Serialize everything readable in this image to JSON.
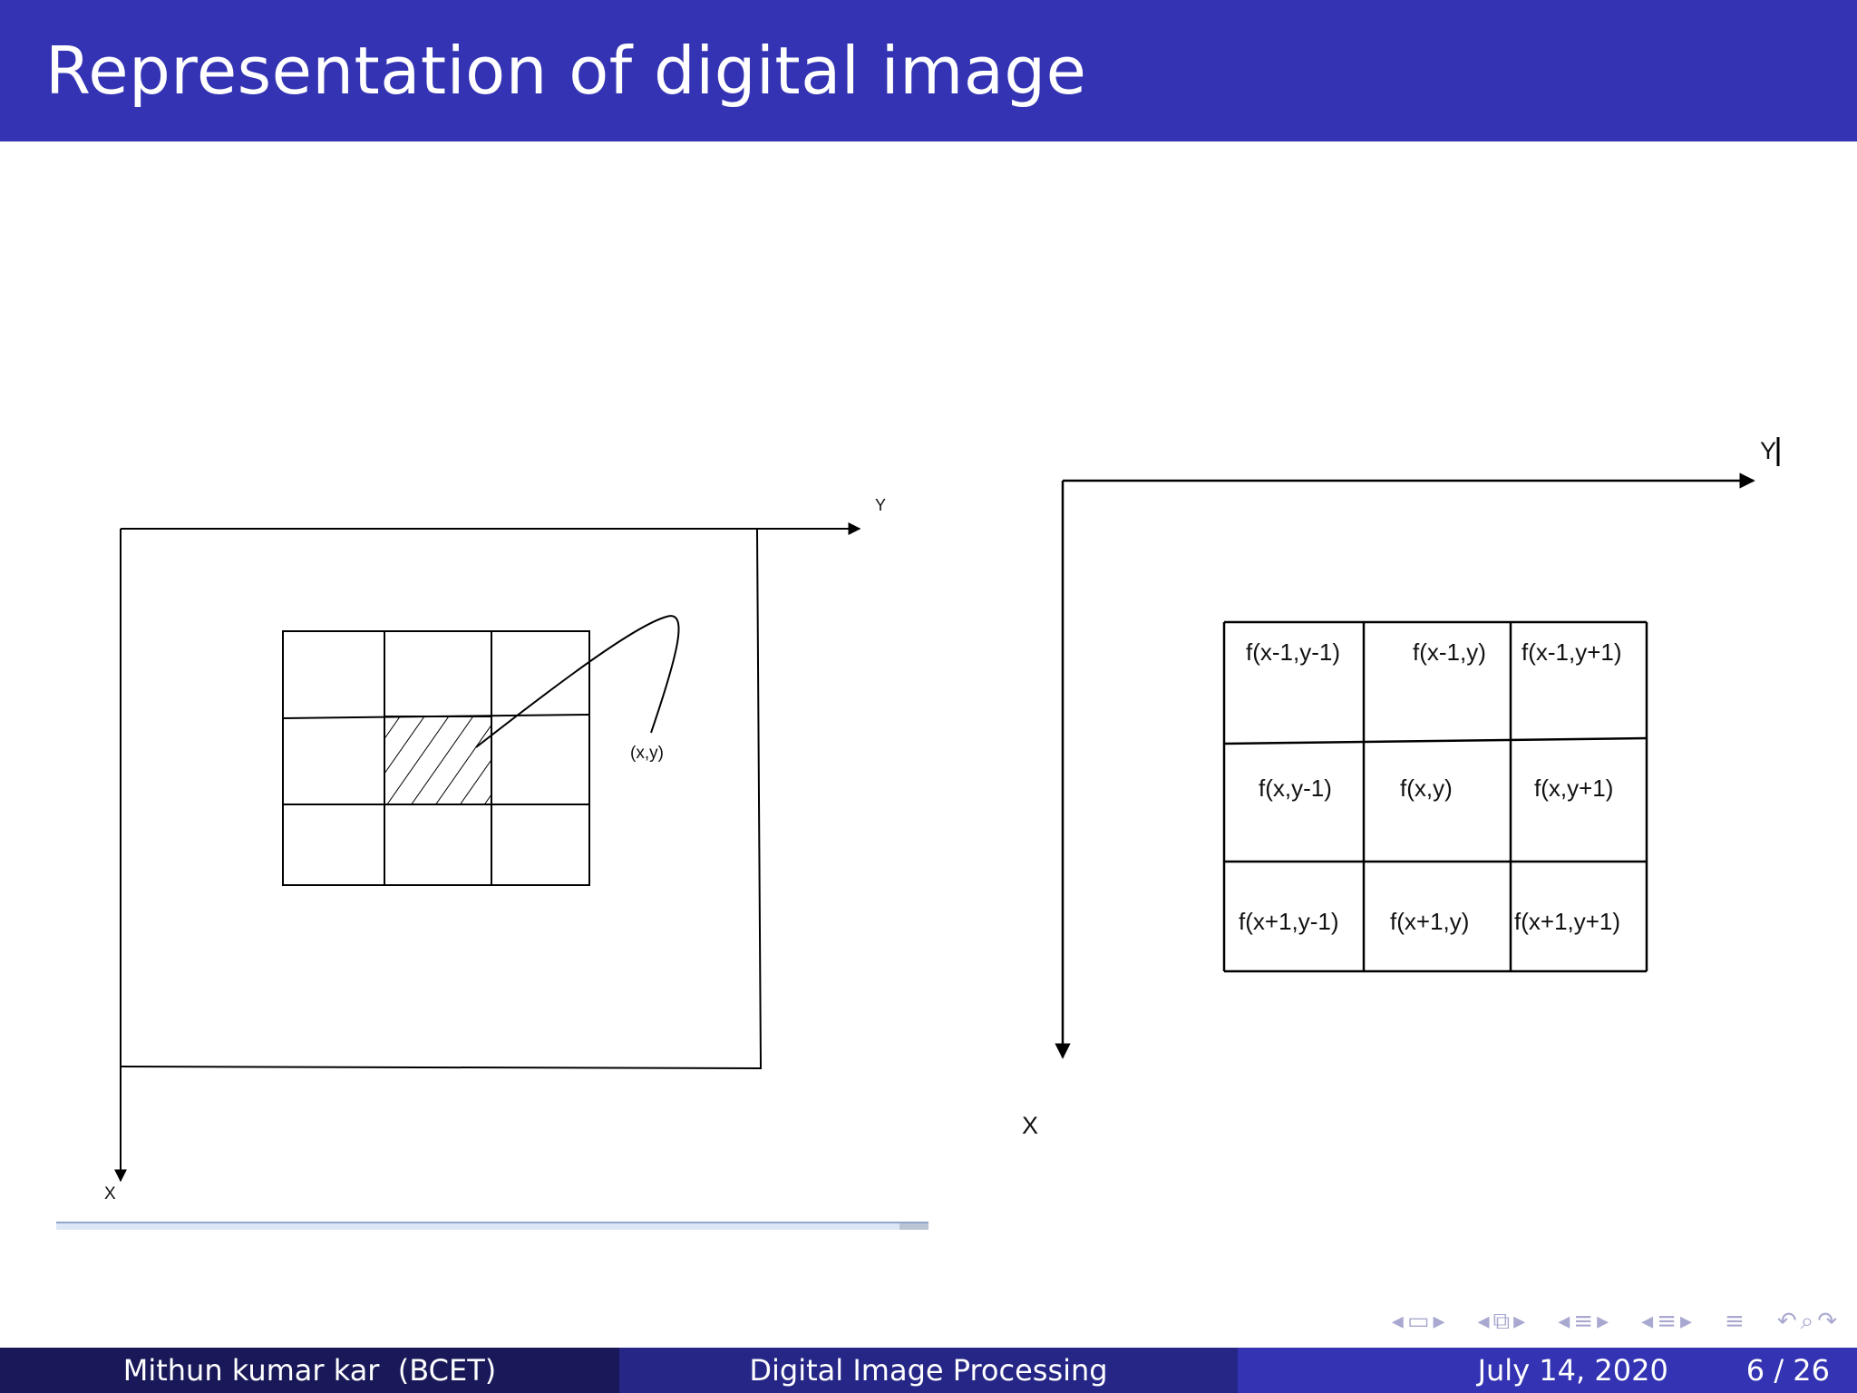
{
  "slide": {
    "title": "Representation of digital image"
  },
  "left_figure": {
    "axis_y_label": "Y",
    "axis_x_label": "X",
    "point_label": "(x,y)"
  },
  "right_figure": {
    "axis_y_label": "Y",
    "axis_x_label": "X",
    "neighborhood": [
      [
        "f(x-1,y-1)",
        "f(x-1,y)",
        "f(x-1,y+1)"
      ],
      [
        "f(x,y-1)",
        "f(x,y)",
        "f(x,y+1)"
      ],
      [
        "f(x+1,y-1)",
        "f(x+1,y)",
        "f(x+1,y+1)"
      ]
    ]
  },
  "navigation": {
    "icons": [
      "frame-prev-icon",
      "frame-icon",
      "frame-next-icon",
      "subsection-prev-icon",
      "subsection-icon",
      "subsection-next-icon",
      "section-prev-icon",
      "section-icon",
      "section-next-icon",
      "subsub-prev-icon",
      "subsub-icon",
      "subsub-next-icon",
      "toc-icon",
      "undo-icon",
      "search-icon",
      "redo-icon"
    ]
  },
  "footer": {
    "author": "Mithun kumar kar  (BCET)",
    "course": "Digital Image Processing",
    "date": "July 14, 2020",
    "page": "6 / 26"
  },
  "colors": {
    "title_bar": "#3333b3",
    "footer_left": "#191959",
    "footer_mid": "#262686",
    "footer_right": "#3333b3",
    "nav_icons": "#a8a8d0"
  }
}
